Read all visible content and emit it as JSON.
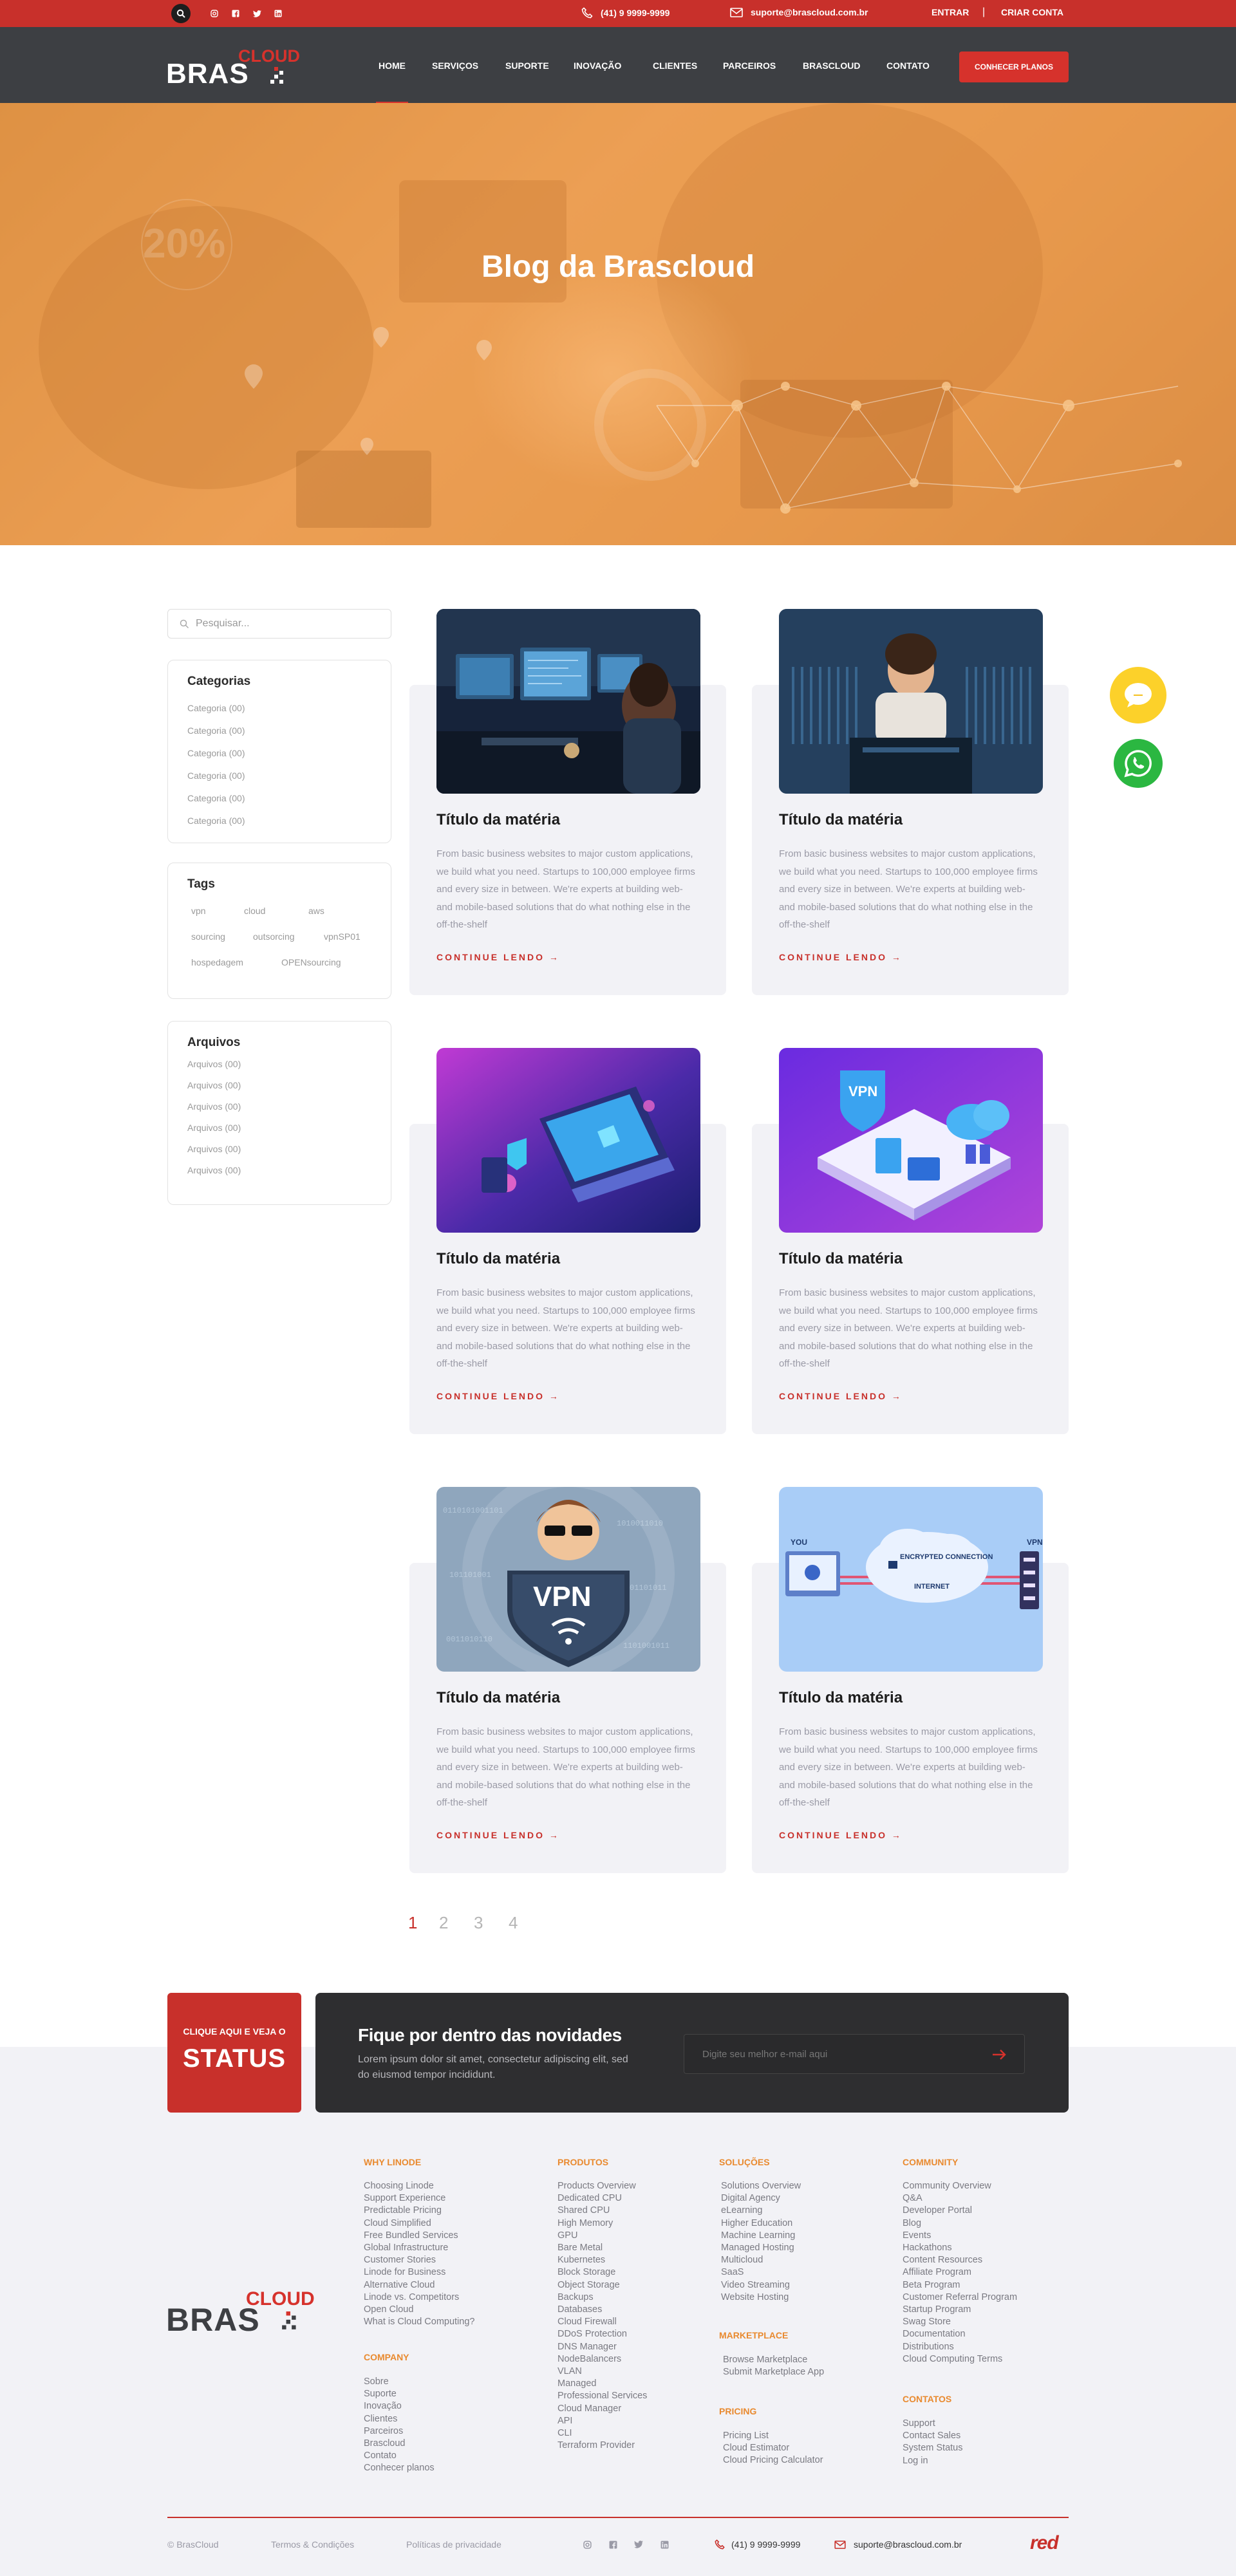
{
  "topbar": {
    "phone": "(41) 9 9999-9999",
    "email": "suporte@brascloud.com.br",
    "login": "ENTRAR",
    "separator": "|",
    "signup": "CRIAR CONTA",
    "social": [
      "instagram-icon",
      "facebook-icon",
      "twitter-icon",
      "linkedin-icon"
    ]
  },
  "brand": {
    "bras": "BRAS",
    "cloud": "CLOUD"
  },
  "nav": {
    "items": [
      "HOME",
      "SERVIÇOS",
      "SUPORTE",
      "INOVAÇÃO",
      "CLIENTES",
      "PARCEIROS",
      "BRASCLOUD",
      "CONTATO"
    ],
    "active": "HOME",
    "cta": "CONHECER PLANOS"
  },
  "hero": {
    "title": "Blog da Brascloud"
  },
  "sidebar": {
    "search_placeholder": "Pesquisar...",
    "categories_title": "Categorias",
    "categories": [
      "Categoria (00)",
      "Categoria (00)",
      "Categoria (00)",
      "Categoria (00)",
      "Categoria (00)",
      "Categoria (00)"
    ],
    "tags_title": "Tags",
    "tags": [
      "vpn",
      "cloud",
      "aws",
      "sourcing",
      "outsorcing",
      "vpnSP01",
      "hospedagem",
      "OPENsourcing"
    ],
    "archives_title": "Arquivos",
    "archives": [
      "Arquivos (00)",
      "Arquivos (00)",
      "Arquivos (00)",
      "Arquivos (00)",
      "Arquivos (00)",
      "Arquivos (00)"
    ]
  },
  "posts": [
    {
      "title": "Título da matéria",
      "excerpt": "From basic business websites to major custom applications, we build what you need. Startups to 100,000 employee firms and every size in between. We're experts at building web- and mobile-based solutions that do what nothing else in the off-the-shelf",
      "link": "CONTINUE LENDO →"
    },
    {
      "title": "Título da matéria",
      "excerpt": "From basic business websites to major custom applications, we build what you need. Startups to 100,000 employee firms and every size in between. We're experts at building web- and mobile-based solutions that do what nothing else in the off-the-shelf",
      "link": "CONTINUE LENDO →"
    },
    {
      "title": "Título da matéria",
      "excerpt": "From basic business websites to major custom applications, we build what you need. Startups to 100,000 employee firms and every size in between. We're experts at building web- and mobile-based solutions that do what nothing else in the off-the-shelf",
      "link": "CONTINUE LENDO →"
    },
    {
      "title": "Título da matéria",
      "excerpt": "From basic business websites to major custom applications, we build what you need. Startups to 100,000 employee firms and every size in between. We're experts at building web- and mobile-based solutions that do what nothing else in the off-the-shelf",
      "link": "CONTINUE LENDO →"
    },
    {
      "title": "Título da matéria",
      "excerpt": "From basic business websites to major custom applications, we build what you need. Startups to 100,000 employee firms and every size in between. We're experts at building web- and mobile-based solutions that do what nothing else in the off-the-shelf",
      "link": "CONTINUE LENDO →"
    },
    {
      "title": "Título da matéria",
      "excerpt": "From basic business websites to major custom applications, we build what you need. Startups to 100,000 employee firms and every size in between. We're experts at building web- and mobile-based solutions that do what nothing else in the off-the-shelf",
      "link": "CONTINUE LENDO →"
    }
  ],
  "image_text": {
    "hero_percent": "20%",
    "vpn": "VPN",
    "you": "YOU",
    "vpn_small": "VPN",
    "encrypted": "ENCRYPTED CONNECTION",
    "internet": "INTERNET"
  },
  "pagination": {
    "pages": [
      "1",
      "2",
      "3",
      "4"
    ],
    "current": "1"
  },
  "status": {
    "small": "CLIQUE AQUI E VEJA O",
    "big": "STATUS"
  },
  "newsletter": {
    "title": "Fique por dentro das novidades",
    "text": "Lorem ipsum dolor sit amet, consectetur adipiscing elit, sed do eiusmod tempor incididunt.",
    "placeholder": "Digite seu melhor e-mail aqui"
  },
  "footer": {
    "why_title": "WHY LINODE",
    "why": [
      "Choosing Linode",
      "Support Experience",
      "Predictable Pricing",
      "Cloud Simplified",
      "Free Bundled Services",
      "Global Infrastructure",
      "Customer Stories",
      "Linode for Business",
      "Alternative Cloud",
      "Linode vs. Competitors",
      "Open Cloud",
      "What is Cloud Computing?"
    ],
    "company_title": "COMPANY",
    "company": [
      "Sobre",
      "Suporte",
      "Inovação",
      "Clientes",
      "Parceiros",
      "Brascloud",
      "Contato",
      "Conhecer planos"
    ],
    "products_title": "PRODUTOS",
    "products": [
      "Products Overview",
      "Dedicated CPU",
      "Shared CPU",
      "High Memory",
      "GPU",
      "Bare Metal",
      "Kubernetes",
      "Block Storage",
      "Object Storage",
      "Backups",
      "Databases",
      "Cloud Firewall",
      "DDoS Protection",
      "DNS Manager",
      "NodeBalancers",
      "VLAN",
      "Managed",
      "Professional Services",
      "Cloud Manager",
      "API",
      "CLI",
      "Terraform Provider"
    ],
    "solutions_title": "SOLUÇÕES",
    "solutions": [
      "Solutions Overview",
      "Digital Agency",
      "eLearning",
      "Higher Education",
      "Machine Learning",
      "Managed Hosting",
      "Multicloud",
      "SaaS",
      "Video Streaming",
      "Website Hosting"
    ],
    "marketplace_title": "MARKETPLACE",
    "marketplace": [
      "Browse Marketplace",
      "Submit Marketplace App"
    ],
    "pricing_title": "PRICING",
    "pricing": [
      "Pricing List",
      "Cloud Estimator",
      "Cloud Pricing Calculator"
    ],
    "community_title": "COMMUNITY",
    "community": [
      "Community Overview",
      "Q&A",
      "Developer Portal",
      "Blog",
      "Events",
      "Hackathons",
      "Content Resources",
      "Affiliate Program",
      "Beta Program",
      "Customer Referral Program",
      "Startup Program",
      "Swag Store",
      "Documentation",
      "Distributions",
      "Cloud Computing Terms"
    ],
    "contacts_title": "CONTATOS",
    "contacts": [
      "Support",
      "Contact Sales",
      "System Status",
      "Log in"
    ],
    "copyright": "© BrasCloud",
    "terms": "Termos & Condições",
    "privacy": "Políticas de privacidade",
    "phone": "(41) 9 9999-9999",
    "email": "suporte@brascloud.com.br",
    "agency": "red"
  },
  "colors": {
    "brand_red": "#c8302b",
    "header_dark": "#3d3f43",
    "hero_orange": "#eb9a4e",
    "footer_orange": "#e98a2f",
    "whatsapp": "#2bb741",
    "chat": "#fcd12a"
  }
}
